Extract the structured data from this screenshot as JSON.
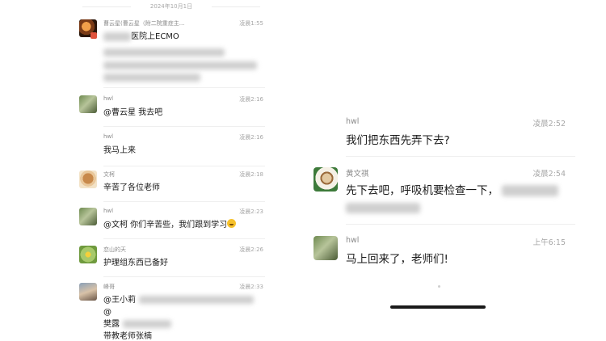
{
  "left_panel": {
    "date_separator": "2024年10月1日",
    "messages": [
      {
        "name": "曹云星(曹云星（附二院重症主...",
        "time": "凌晨1:55",
        "text": "医院上ECMO"
      },
      {
        "name": "hwl",
        "time": "凌晨2:16",
        "text": "@曹云星 我去吧"
      },
      {
        "name": "hwl",
        "time": "凌晨2:16",
        "text": "我马上来"
      },
      {
        "name": "文柯",
        "time": "凌晨2:18",
        "text": "辛苦了各位老师"
      },
      {
        "name": "hwl",
        "time": "凌晨2:23",
        "text": "@文柯 你们辛苦些，我们跟到学习"
      },
      {
        "name": "恋山的天",
        "time": "凌晨2:26",
        "text": "护理组东西已备好"
      },
      {
        "name": "峰哥",
        "time": "凌晨2:33",
        "text_a": "@王小莉",
        "text_b": "@",
        "text_c": "樊露",
        "text_d": "带教老师张楠"
      }
    ]
  },
  "right_panel": {
    "messages": [
      {
        "name": "hwl",
        "time": "凌晨2:52",
        "text": "我们把东西先弄下去?"
      },
      {
        "name": "黄文祺",
        "time": "凌晨2:54",
        "text": "先下去吧，呼吸机要检查一下，"
      },
      {
        "name": "hwl",
        "time": "上午6:15",
        "text": "马上回来了，老师们!"
      }
    ]
  }
}
